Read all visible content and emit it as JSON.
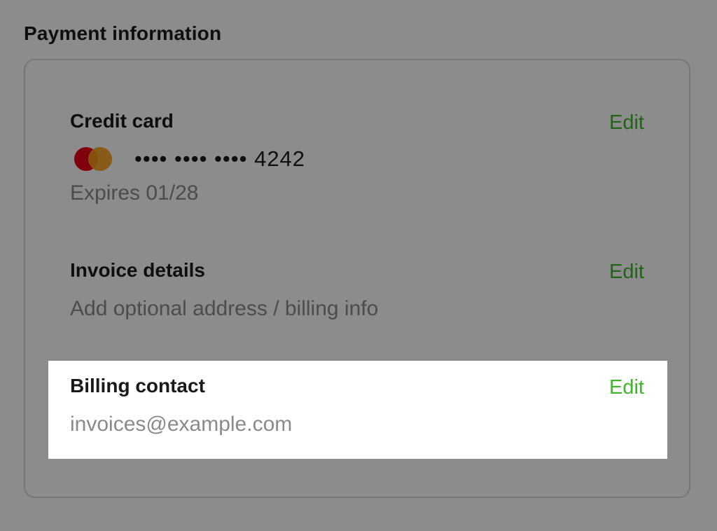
{
  "section": {
    "title": "Payment information"
  },
  "credit_card": {
    "title": "Credit card",
    "edit_label": "Edit",
    "brand_icon": "mastercard-logo-icon",
    "masked_number": "•••• •••• •••• 4242",
    "expiry": "Expires 01/28"
  },
  "invoice_details": {
    "title": "Invoice details",
    "edit_label": "Edit",
    "description": "Add optional address / billing info"
  },
  "billing_contact": {
    "title": "Billing contact",
    "edit_label": "Edit",
    "email": "invoices@example.com"
  },
  "colors": {
    "accent": "#41b52b",
    "overlay": "rgba(0,0,0,0.45)",
    "mastercard_red": "#eb001b",
    "mastercard_orange": "#f79e1b"
  }
}
